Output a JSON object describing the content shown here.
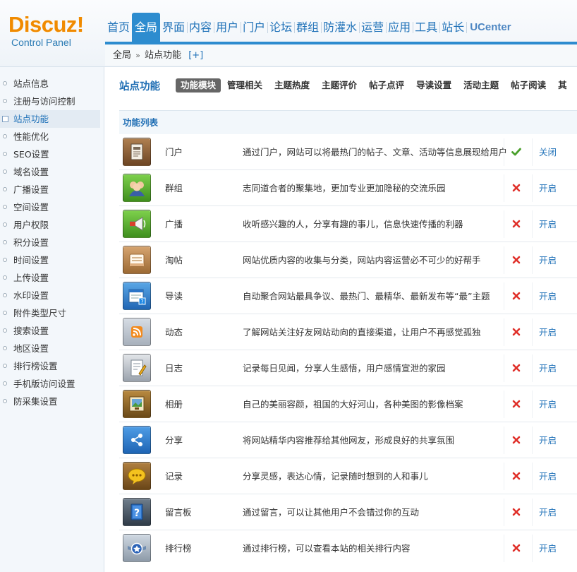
{
  "logo": {
    "brand": "Discuz!",
    "subtitle": "Control Panel"
  },
  "topnav": [
    {
      "label": "首页",
      "active": false
    },
    {
      "label": "全局",
      "active": true
    },
    {
      "label": "界面",
      "active": false
    },
    {
      "label": "内容",
      "active": false
    },
    {
      "label": "用户",
      "active": false
    },
    {
      "label": "门户",
      "active": false
    },
    {
      "label": "论坛",
      "active": false
    },
    {
      "label": "群组",
      "active": false
    },
    {
      "label": "防灌水",
      "active": false
    },
    {
      "label": "运营",
      "active": false
    },
    {
      "label": "应用",
      "active": false
    },
    {
      "label": "工具",
      "active": false
    },
    {
      "label": "站长",
      "active": false
    },
    {
      "label": "UCenter",
      "active": false
    }
  ],
  "breadcrumb": {
    "root": "全局",
    "separator": "»",
    "current": "站点功能",
    "add": "[+]"
  },
  "sidebar": [
    {
      "label": "站点信息",
      "active": false
    },
    {
      "label": "注册与访问控制",
      "active": false
    },
    {
      "label": "站点功能",
      "active": true
    },
    {
      "label": "性能优化",
      "active": false
    },
    {
      "label": "SEO设置",
      "active": false
    },
    {
      "label": "域名设置",
      "active": false
    },
    {
      "label": "广播设置",
      "active": false
    },
    {
      "label": "空间设置",
      "active": false
    },
    {
      "label": "用户权限",
      "active": false
    },
    {
      "label": "积分设置",
      "active": false
    },
    {
      "label": "时间设置",
      "active": false
    },
    {
      "label": "上传设置",
      "active": false
    },
    {
      "label": "水印设置",
      "active": false
    },
    {
      "label": "附件类型尺寸",
      "active": false
    },
    {
      "label": "搜索设置",
      "active": false
    },
    {
      "label": "地区设置",
      "active": false
    },
    {
      "label": "排行榜设置",
      "active": false
    },
    {
      "label": "手机版访问设置",
      "active": false
    },
    {
      "label": "防采集设置",
      "active": false
    }
  ],
  "page": {
    "title": "站点功能",
    "tabs": [
      {
        "label": "功能模块",
        "active": true
      },
      {
        "label": "管理相关",
        "active": false
      },
      {
        "label": "主题热度",
        "active": false
      },
      {
        "label": "主题评价",
        "active": false
      },
      {
        "label": "帖子点评",
        "active": false
      },
      {
        "label": "导读设置",
        "active": false
      },
      {
        "label": "活动主题",
        "active": false
      },
      {
        "label": "帖子阅读",
        "active": false
      },
      {
        "label": "其",
        "active": false
      }
    ],
    "section_title": "功能列表"
  },
  "colors": {
    "accent": "#2d8ccf",
    "link": "#2273b9",
    "enabled": "#4aa02c",
    "disabled": "#e0302a"
  },
  "features": [
    {
      "name": "门户",
      "icon": "portal-icon",
      "desc": "通过门户，网站可以将最热门的帖子、文章、活动等信息展现给用户",
      "enabled": true,
      "action": "关闭"
    },
    {
      "name": "群组",
      "icon": "group-icon",
      "desc": "志同道合者的聚集地，更加专业更加隐秘的交流乐园",
      "enabled": false,
      "action": "开启"
    },
    {
      "name": "广播",
      "icon": "broadcast-icon",
      "desc": "收听感兴趣的人，分享有趣的事儿，信息快速传播的利器",
      "enabled": false,
      "action": "开启"
    },
    {
      "name": "淘帖",
      "icon": "collection-icon",
      "desc": "网站优质内容的收集与分类，网站内容运营必不可少的好帮手",
      "enabled": false,
      "action": "开启"
    },
    {
      "name": "导读",
      "icon": "guide-icon",
      "desc": "自动聚合网站最具争议、最热门、最精华、最新发布等“最”主题",
      "enabled": false,
      "action": "开启"
    },
    {
      "name": "动态",
      "icon": "feed-icon",
      "desc": "了解网站关注好友网站动向的直接渠道，让用户不再感觉孤独",
      "enabled": false,
      "action": "开启"
    },
    {
      "name": "日志",
      "icon": "blog-icon",
      "desc": "记录每日见闻，分享人生感悟，用户感情宣泄的家园",
      "enabled": false,
      "action": "开启"
    },
    {
      "name": "相册",
      "icon": "album-icon",
      "desc": "自己的美丽容颜，祖国的大好河山，各种美图的影像档案",
      "enabled": false,
      "action": "开启"
    },
    {
      "name": "分享",
      "icon": "share-icon",
      "desc": "将网站精华内容推荐给其他网友，形成良好的共享氛围",
      "enabled": false,
      "action": "开启"
    },
    {
      "name": "记录",
      "icon": "doing-icon",
      "desc": "分享灵感，表达心情，记录随时想到的人和事儿",
      "enabled": false,
      "action": "开启"
    },
    {
      "name": "留言板",
      "icon": "wall-icon",
      "desc": "通过留言，可以让其他用户不会错过你的互动",
      "enabled": false,
      "action": "开启"
    },
    {
      "name": "排行榜",
      "icon": "ranklist-icon",
      "desc": "通过排行榜，可以查看本站的相关排行内容",
      "enabled": false,
      "action": "开启"
    }
  ]
}
